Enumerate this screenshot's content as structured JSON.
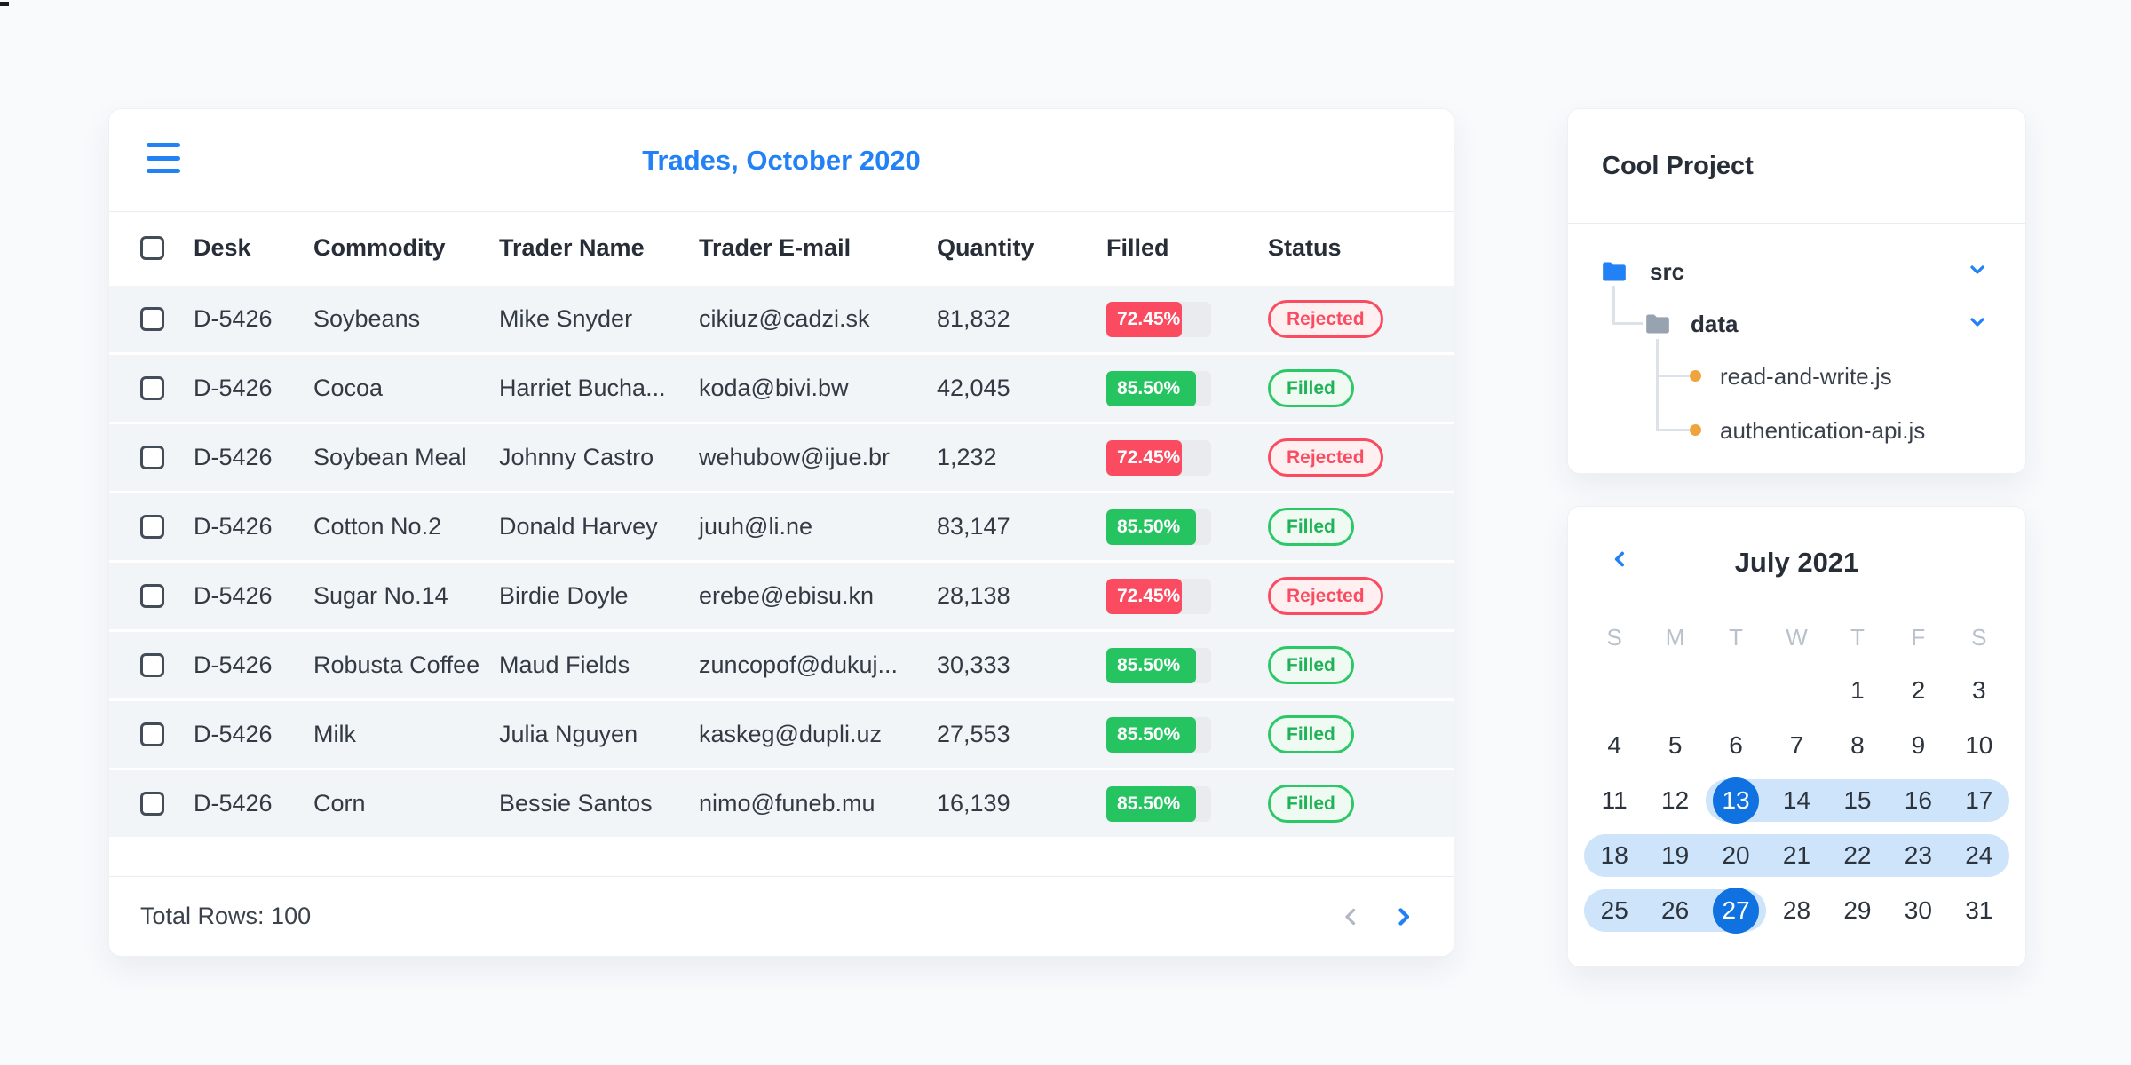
{
  "colors": {
    "accent_blue": "#2181f5",
    "selected_day_blue": "#0f72e0",
    "range_light_blue": "#cde4fa",
    "red": "#fa4b61",
    "green": "#25c460",
    "track_gray": "#e9ebef",
    "row_bg": "#f2f5f8",
    "muted_gray": "#b9c1cc",
    "file_dot_orange": "#f0a43e"
  },
  "trades_panel": {
    "title": "Trades, October 2020",
    "columns": [
      "Desk",
      "Commodity",
      "Trader Name",
      "Trader E-mail",
      "Quantity",
      "Filled",
      "Status"
    ],
    "rows": [
      {
        "desk": "D-5426",
        "commodity": "Soybeans",
        "trader": "Mike Snyder",
        "email": "cikiuz@cadzi.sk",
        "quantity": "81,832",
        "filled_label": "72.45%",
        "filled_value": 72.45,
        "status": "Rejected"
      },
      {
        "desk": "D-5426",
        "commodity": "Cocoa",
        "trader": "Harriet Bucha...",
        "email": "koda@bivi.bw",
        "quantity": "42,045",
        "filled_label": "85.50%",
        "filled_value": 85.5,
        "status": "Filled"
      },
      {
        "desk": "D-5426",
        "commodity": "Soybean Meal",
        "trader": "Johnny Castro",
        "email": "wehubow@ijue.br",
        "quantity": "1,232",
        "filled_label": "72.45%",
        "filled_value": 72.45,
        "status": "Rejected"
      },
      {
        "desk": "D-5426",
        "commodity": "Cotton No.2",
        "trader": "Donald Harvey",
        "email": "juuh@li.ne",
        "quantity": "83,147",
        "filled_label": "85.50%",
        "filled_value": 85.5,
        "status": "Filled"
      },
      {
        "desk": "D-5426",
        "commodity": "Sugar No.14",
        "trader": "Birdie Doyle",
        "email": "erebe@ebisu.kn",
        "quantity": "28,138",
        "filled_label": "72.45%",
        "filled_value": 72.45,
        "status": "Rejected"
      },
      {
        "desk": "D-5426",
        "commodity": "Robusta Coffee",
        "trader": "Maud Fields",
        "email": "zuncopof@dukuj...",
        "quantity": "30,333",
        "filled_label": "85.50%",
        "filled_value": 85.5,
        "status": "Filled"
      },
      {
        "desk": "D-5426",
        "commodity": "Milk",
        "trader": "Julia Nguyen",
        "email": "kaskeg@dupli.uz",
        "quantity": "27,553",
        "filled_label": "85.50%",
        "filled_value": 85.5,
        "status": "Filled"
      },
      {
        "desk": "D-5426",
        "commodity": "Corn",
        "trader": "Bessie Santos",
        "email": "nimo@funeb.mu",
        "quantity": "16,139",
        "filled_label": "85.50%",
        "filled_value": 85.5,
        "status": "Filled"
      }
    ],
    "footer": {
      "total_label": "Total Rows: 100"
    }
  },
  "file_panel": {
    "title": "Cool Project",
    "tree": {
      "folder_src": "src",
      "folder_data": "data",
      "file_1": "read-and-write.js",
      "file_2": "authentication-api.js"
    }
  },
  "calendar": {
    "title": "July 2021",
    "weekdays": [
      "S",
      "M",
      "T",
      "W",
      "T",
      "F",
      "S"
    ],
    "selected_range": {
      "start": 13,
      "end": 27
    },
    "weeks": [
      [
        null,
        null,
        null,
        null,
        {
          "n": 1
        },
        {
          "n": 2
        },
        {
          "n": 3
        }
      ],
      [
        {
          "n": 4
        },
        {
          "n": 5
        },
        {
          "n": 6
        },
        {
          "n": 7
        },
        {
          "n": 8
        },
        {
          "n": 9
        },
        {
          "n": 10
        }
      ],
      [
        {
          "n": 11
        },
        {
          "n": 12
        },
        {
          "n": 13,
          "state": "selected"
        },
        {
          "n": 14,
          "state": "range"
        },
        {
          "n": 15,
          "state": "range"
        },
        {
          "n": 16,
          "state": "range"
        },
        {
          "n": 17,
          "state": "range"
        }
      ],
      [
        {
          "n": 18,
          "state": "range"
        },
        {
          "n": 19,
          "state": "range"
        },
        {
          "n": 20,
          "state": "range"
        },
        {
          "n": 21,
          "state": "range"
        },
        {
          "n": 22,
          "state": "range"
        },
        {
          "n": 23,
          "state": "range"
        },
        {
          "n": 24,
          "state": "range"
        }
      ],
      [
        {
          "n": 25,
          "state": "range"
        },
        {
          "n": 26,
          "state": "range"
        },
        {
          "n": 27,
          "state": "selected"
        },
        {
          "n": 28
        },
        {
          "n": 29
        },
        {
          "n": 30
        },
        {
          "n": 31
        }
      ]
    ]
  }
}
